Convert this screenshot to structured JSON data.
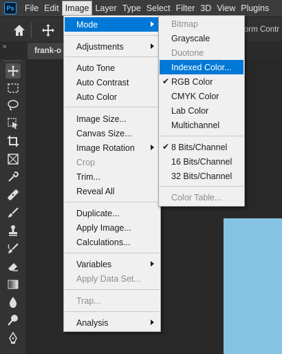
{
  "menubar": {
    "logo": "Ps",
    "items": [
      "File",
      "Edit",
      "Image",
      "Layer",
      "Type",
      "Select",
      "Filter",
      "3D",
      "View",
      "Plugins"
    ],
    "active": "Image"
  },
  "options_bar": {
    "partial_text": "orm Contr"
  },
  "document_tab": {
    "title": "frank-o"
  },
  "collapse_glyph": "»",
  "image_menu": {
    "groups": [
      [
        {
          "label": "Mode",
          "submenu": true,
          "highlighted": true
        }
      ],
      [
        {
          "label": "Adjustments",
          "submenu": true
        }
      ],
      [
        {
          "label": "Auto Tone"
        },
        {
          "label": "Auto Contrast"
        },
        {
          "label": "Auto Color"
        }
      ],
      [
        {
          "label": "Image Size..."
        },
        {
          "label": "Canvas Size..."
        },
        {
          "label": "Image Rotation",
          "submenu": true
        },
        {
          "label": "Crop",
          "disabled": true
        },
        {
          "label": "Trim..."
        },
        {
          "label": "Reveal All"
        }
      ],
      [
        {
          "label": "Duplicate..."
        },
        {
          "label": "Apply Image..."
        },
        {
          "label": "Calculations..."
        }
      ],
      [
        {
          "label": "Variables",
          "submenu": true
        },
        {
          "label": "Apply Data Set...",
          "disabled": true
        }
      ],
      [
        {
          "label": "Trap...",
          "disabled": true
        }
      ],
      [
        {
          "label": "Analysis",
          "submenu": true
        }
      ]
    ]
  },
  "mode_menu": {
    "groups": [
      [
        {
          "label": "Bitmap",
          "disabled": true
        },
        {
          "label": "Grayscale"
        },
        {
          "label": "Duotone",
          "disabled": true
        },
        {
          "label": "Indexed Color...",
          "highlighted": true
        },
        {
          "label": "RGB Color",
          "checked": true
        },
        {
          "label": "CMYK Color"
        },
        {
          "label": "Lab Color"
        },
        {
          "label": "Multichannel"
        }
      ],
      [
        {
          "label": "8 Bits/Channel",
          "checked": true
        },
        {
          "label": "16 Bits/Channel"
        },
        {
          "label": "32 Bits/Channel"
        }
      ],
      [
        {
          "label": "Color Table...",
          "disabled": true
        }
      ]
    ]
  },
  "check_glyph": "✔",
  "colors": {
    "highlight": "#0078d7",
    "canvas_image": "#86c3e3"
  },
  "tools": [
    "move-tool-icon",
    "marquee-tool-icon",
    "lasso-tool-icon",
    "object-select-tool-icon",
    "crop-tool-icon",
    "frame-tool-icon",
    "eyedropper-tool-icon",
    "healing-brush-tool-icon",
    "brush-tool-icon",
    "clone-stamp-tool-icon",
    "history-brush-tool-icon",
    "eraser-tool-icon",
    "gradient-tool-icon",
    "blur-tool-icon",
    "dodge-tool-icon",
    "pen-tool-icon"
  ]
}
